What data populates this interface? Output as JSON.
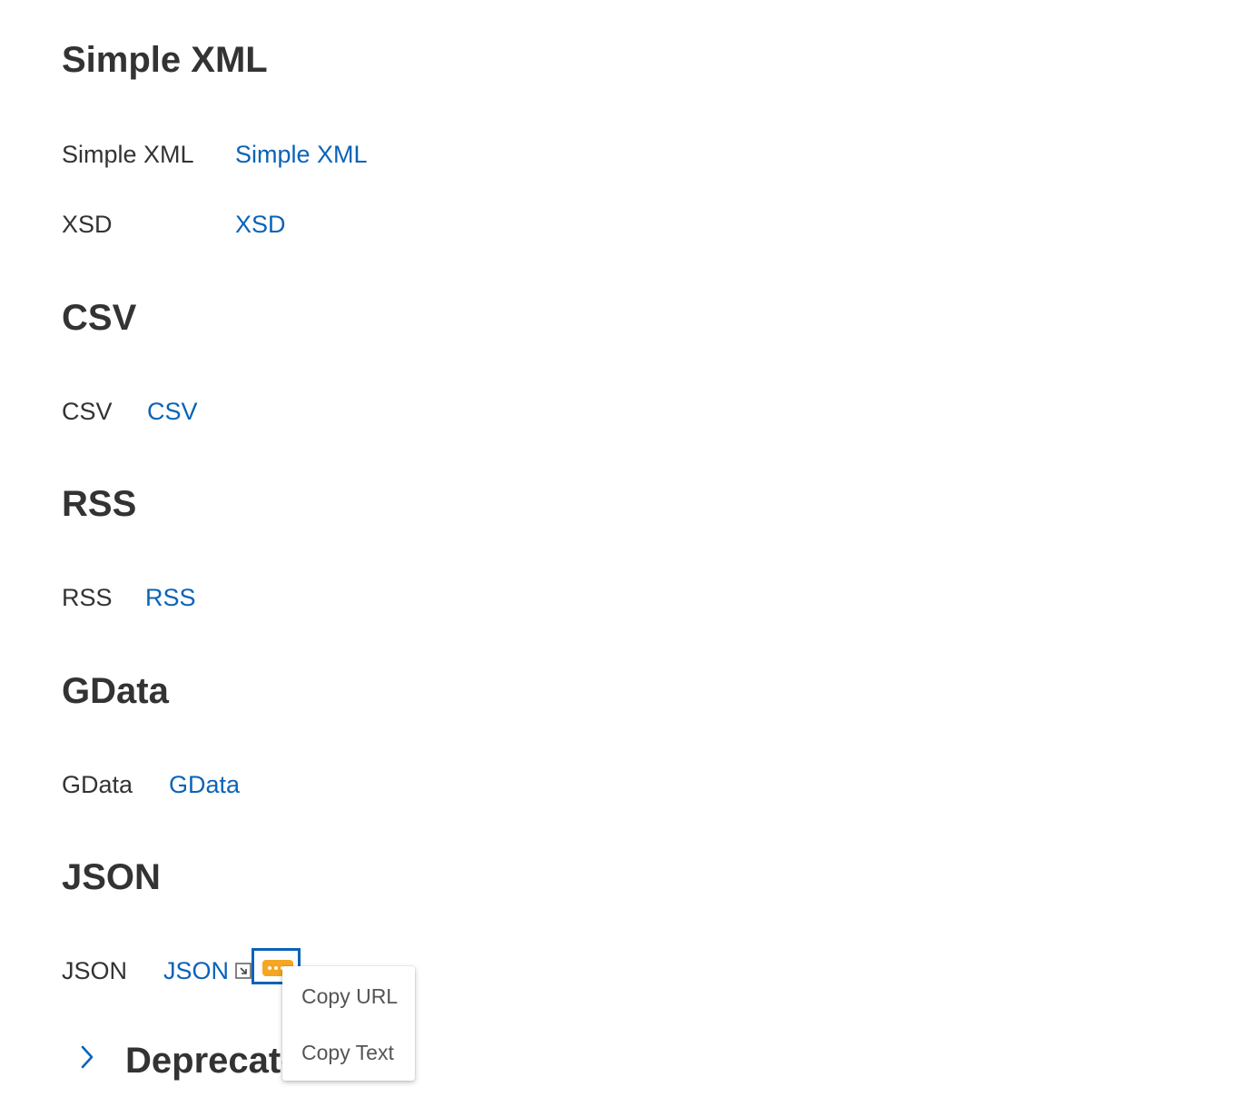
{
  "sections": {
    "simple_xml": {
      "title": "Simple XML",
      "rows": [
        {
          "label": "Simple XML",
          "link": "Simple XML"
        },
        {
          "label": "XSD",
          "link": "XSD"
        }
      ]
    },
    "csv": {
      "title": "CSV",
      "rows": [
        {
          "label": "CSV",
          "link": "CSV"
        }
      ]
    },
    "rss": {
      "title": "RSS",
      "rows": [
        {
          "label": "RSS",
          "link": "RSS"
        }
      ]
    },
    "gdata": {
      "title": "GData",
      "rows": [
        {
          "label": "GData",
          "link": "GData"
        }
      ]
    },
    "json": {
      "title": "JSON",
      "rows": [
        {
          "label": "JSON",
          "link": "JSON"
        }
      ]
    },
    "deprecated": {
      "title": "Deprecated"
    }
  },
  "context_menu": {
    "items": [
      "Copy URL",
      "Copy Text"
    ]
  },
  "icons": {
    "external_link": "external-link-icon",
    "more_actions": "more-actions-icon",
    "expand": "chevron-right-icon"
  },
  "colors": {
    "link": "#0a63b8",
    "text": "#333333",
    "focus_border": "#0a63b8",
    "more_button": "#f5a623"
  }
}
